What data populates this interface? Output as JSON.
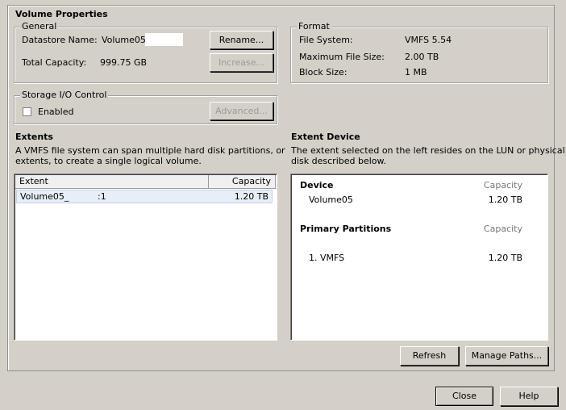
{
  "volume_properties": {
    "title": "Volume Properties",
    "general": {
      "legend": "General",
      "datastore_name_label": "Datastore Name:",
      "datastore_name_value": "Volume05_",
      "total_capacity_label": "Total Capacity:",
      "total_capacity_value": "999.75 GB",
      "rename_button": "Rename...",
      "increase_button": "Increase..."
    },
    "format": {
      "legend": "Format",
      "file_system_label": "File System:",
      "file_system_value": "VMFS 5.54",
      "max_file_size_label": "Maximum File Size:",
      "max_file_size_value": "2.00 TB",
      "block_size_label": "Block Size:",
      "block_size_value": "1 MB"
    },
    "storage_io": {
      "legend": "Storage I/O Control",
      "enabled_label": "Enabled",
      "enabled_checked": false,
      "advanced_button": "Advanced..."
    }
  },
  "extents": {
    "title": "Extents",
    "description_line1": "A VMFS file system can span multiple hard disk partitions, or",
    "description_line2": "extents, to create a single logical volume.",
    "columns": [
      "Extent",
      "Capacity"
    ],
    "rows": [
      {
        "name_prefix": "Volume05_",
        "name_suffix": ":1",
        "capacity": "1.20 TB"
      }
    ]
  },
  "extent_device": {
    "title": "Extent Device",
    "description_line1": "The extent selected on the left resides on the LUN or physical",
    "description_line2": "disk described below.",
    "device_header": "Device",
    "capacity_header": "Capacity",
    "device_name": "Volume05",
    "device_capacity": "1.20 TB",
    "primary_partitions_header": "Primary Partitions",
    "partitions_capacity_header": "Capacity",
    "partition_name": "1. VMFS",
    "partition_capacity": "1.20 TB"
  },
  "buttons": {
    "refresh": "Refresh",
    "manage_paths": "Manage Paths...",
    "close": "Close",
    "help": "Help"
  }
}
